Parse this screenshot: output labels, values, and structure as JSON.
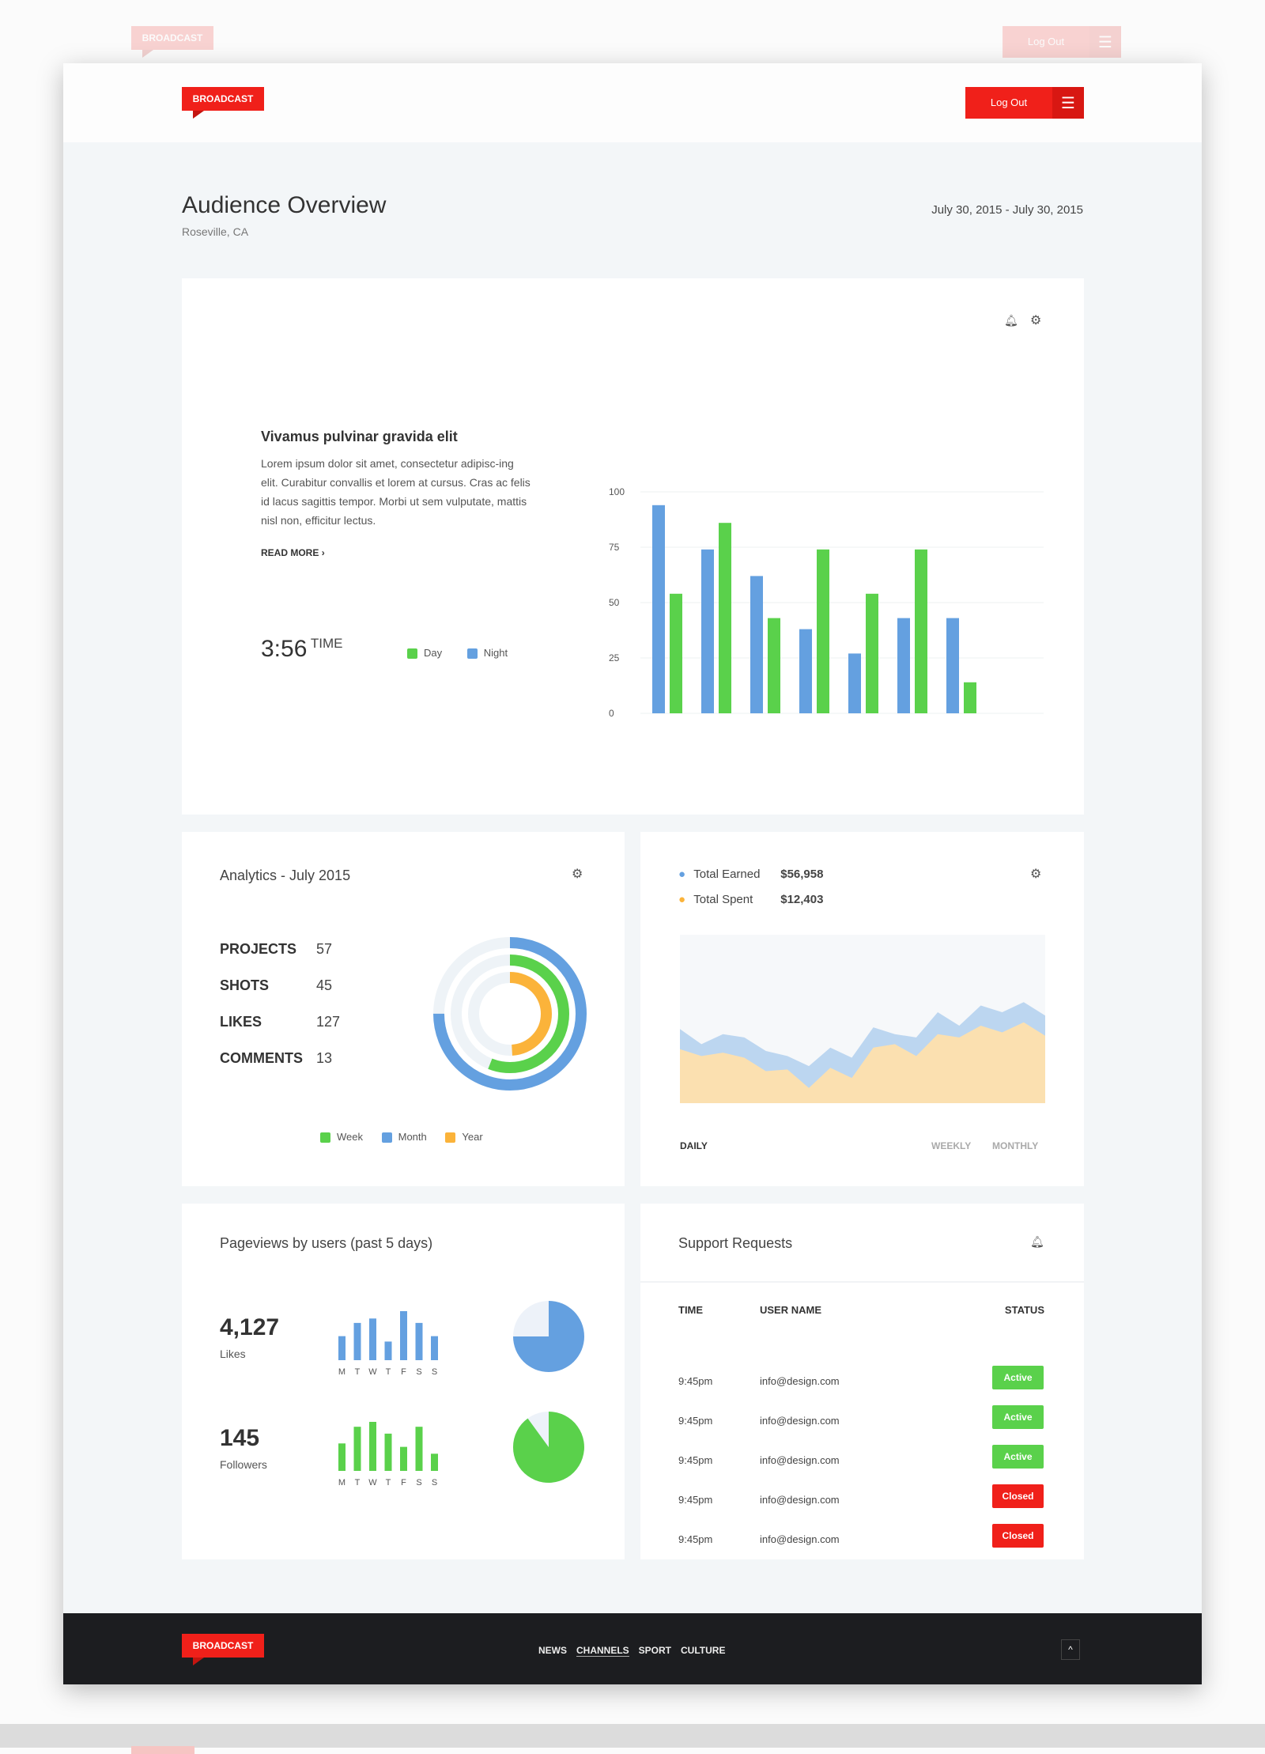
{
  "brand": "BROADCAST",
  "header": {
    "logout_label": "Log Out",
    "menu_icon": "hamburger-icon"
  },
  "page": {
    "title": "Audience Overview",
    "location": "Roseville, CA",
    "date_range": "July 30, 2015 - July 30, 2015"
  },
  "overview": {
    "heading": "Vivamus pulvinar gravida elit",
    "body": "Lorem ipsum dolor sit amet, consectetur adipisc-ing elit. Curabitur convallis et lorem at cursus. Cras ac felis id lacus sagittis tempor. Morbi ut sem vulputate, mattis nisl non, efficitur lectus.",
    "read_more": "READ MORE",
    "time_value": "3:56",
    "time_label": "TIME"
  },
  "chart_data": [
    {
      "type": "bar",
      "yticks": [
        "100",
        "75",
        "50",
        "25",
        "0"
      ],
      "ylim": [
        0,
        100
      ],
      "grid": true,
      "series": [
        {
          "name": "Night",
          "color": "#64a0e0",
          "values": [
            94,
            74,
            62,
            38,
            27,
            43,
            43
          ]
        },
        {
          "name": "Day",
          "color": "#5ad14b",
          "values": [
            54,
            86,
            43,
            74,
            54,
            74,
            14
          ]
        }
      ],
      "legend": [
        "Day",
        "Night"
      ]
    },
    {
      "type": "area",
      "series": [
        {
          "name": "Total Earned",
          "color": "#bcd6f0",
          "values": [
            44,
            35,
            41,
            39,
            31,
            28,
            22,
            33,
            27,
            45,
            41,
            39,
            54,
            46,
            58,
            54,
            60,
            52
          ]
        },
        {
          "name": "Total Spent",
          "color": "#fbe0b0",
          "values": [
            32,
            28,
            30,
            27,
            19,
            20,
            9,
            21,
            15,
            33,
            35,
            28,
            41,
            39,
            46,
            42,
            48,
            40
          ]
        }
      ]
    },
    {
      "type": "bar",
      "name": "Likes",
      "categories": [
        "M",
        "T",
        "W",
        "T",
        "F",
        "S",
        "S"
      ],
      "values": [
        49,
        76,
        85,
        38,
        100,
        76,
        49
      ],
      "color": "#64a0e0"
    },
    {
      "type": "bar",
      "name": "Followers",
      "categories": [
        "M",
        "T",
        "W",
        "T",
        "F",
        "S",
        "S"
      ],
      "values": [
        56,
        90,
        100,
        76,
        49,
        90,
        35
      ],
      "color": "#5ad14b"
    }
  ],
  "analytics": {
    "title": "Analytics - July 2015",
    "stats": [
      {
        "label": "PROJECTS",
        "value": "57"
      },
      {
        "label": "SHOTS",
        "value": "45"
      },
      {
        "label": "LIKES",
        "value": "127"
      },
      {
        "label": "COMMENTS",
        "value": "13"
      }
    ],
    "rings": [
      {
        "name": "Month",
        "color": "#64a0e0",
        "fraction": 0.75
      },
      {
        "name": "Week",
        "color": "#5ad14b",
        "fraction": 0.56
      },
      {
        "name": "Year",
        "color": "#fbb33a",
        "fraction": 0.49
      }
    ],
    "legend": [
      "Week",
      "Month",
      "Year"
    ]
  },
  "earnings": {
    "earned_label": "Total Earned",
    "earned_value": "$56,958",
    "spent_label": "Total Spent",
    "spent_value": "$12,403",
    "tabs": [
      "DAILY",
      "WEEKLY",
      "MONTHLY"
    ],
    "active_tab": "DAILY"
  },
  "pageviews": {
    "title": "Pageviews by users (past 5 days)",
    "items": [
      {
        "value": "4,127",
        "label": "Likes",
        "pie_fraction": 0.75,
        "color": "#64a0e0"
      },
      {
        "value": "145",
        "label": "Followers",
        "pie_fraction": 0.9,
        "color": "#5ad14b"
      }
    ]
  },
  "support": {
    "title": "Support Requests",
    "columns": [
      "TIME",
      "USER NAME",
      "STATUS"
    ],
    "rows": [
      {
        "time": "9:45pm",
        "user": "info@design.com",
        "status": "Active"
      },
      {
        "time": "9:45pm",
        "user": "info@design.com",
        "status": "Active"
      },
      {
        "time": "9:45pm",
        "user": "info@design.com",
        "status": "Active"
      },
      {
        "time": "9:45pm",
        "user": "info@design.com",
        "status": "Closed"
      },
      {
        "time": "9:45pm",
        "user": "info@design.com",
        "status": "Closed"
      }
    ],
    "status_colors": {
      "Active": "#5ad14b",
      "Closed": "#f0201a"
    }
  },
  "footer": {
    "nav": [
      "NEWS",
      "CHANNELS",
      "SPORT",
      "CULTURE"
    ],
    "active": "CHANNELS"
  }
}
